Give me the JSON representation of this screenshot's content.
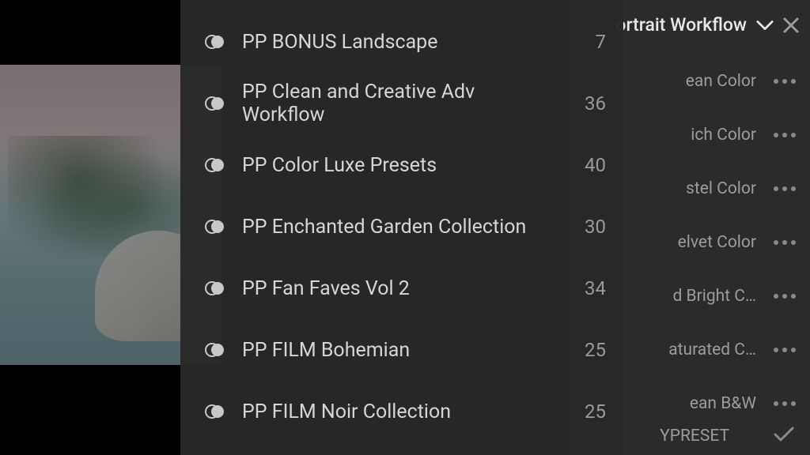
{
  "right_panel": {
    "title": "ortrait Workflow",
    "presets": [
      "ean Color",
      "ich Color",
      "stel Color",
      "elvet Color",
      "d Bright C…",
      "aturated C…",
      "ean B&W"
    ],
    "bottom_label": "YPRESET"
  },
  "groups": [
    {
      "name": "PP BONUS Landscape",
      "count": 7
    },
    {
      "name": "PP Clean and Creative Adv Workflow",
      "count": 36
    },
    {
      "name": "PP Color Luxe Presets",
      "count": 40
    },
    {
      "name": "PP Enchanted Garden Collection",
      "count": 30
    },
    {
      "name": "PP Fan Faves Vol 2",
      "count": 34
    },
    {
      "name": "PP FILM Bohemian",
      "count": 25
    },
    {
      "name": "PP FILM Noir Collection",
      "count": 25
    }
  ]
}
